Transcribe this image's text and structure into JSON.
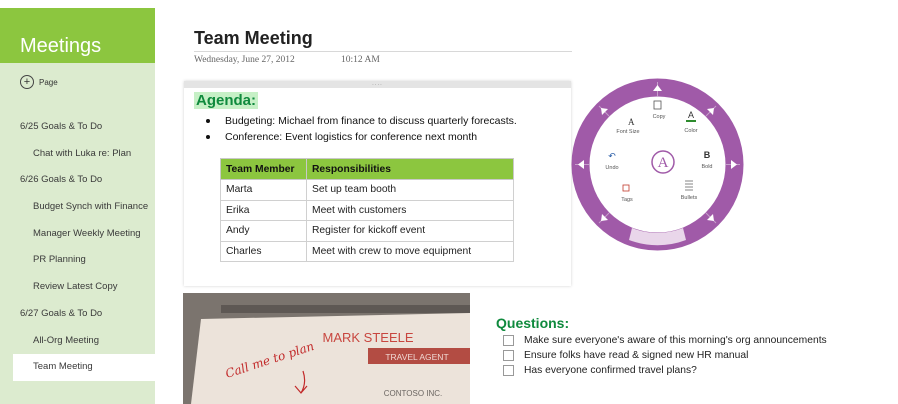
{
  "notebook": {
    "section_title": "Meetings",
    "add_page_label": "Page",
    "pages": [
      {
        "label": "6/25 Goals & To Do",
        "level": 0
      },
      {
        "label": "Chat with Luka re: Plan",
        "level": 1
      },
      {
        "label": "6/26 Goals & To Do",
        "level": 0
      },
      {
        "label": "Budget Synch with Finance",
        "level": 1
      },
      {
        "label": "Manager Weekly Meeting",
        "level": 1
      },
      {
        "label": "PR Planning",
        "level": 1
      },
      {
        "label": "Review Latest Copy",
        "level": 1
      },
      {
        "label": "6/27 Goals & To Do",
        "level": 0
      },
      {
        "label": "All-Org Meeting",
        "level": 1
      },
      {
        "label": "Team Meeting",
        "level": 1,
        "selected": true
      }
    ]
  },
  "page": {
    "title": "Team Meeting",
    "date": "Wednesday, June 27, 2012",
    "time": "10:12 AM"
  },
  "agenda": {
    "handle": "....",
    "heading": "Agenda:",
    "bullets": [
      "Budgeting:  Michael from finance to discuss quarterly forecasts.",
      "Conference: Event logistics for conference next month"
    ],
    "table": {
      "headers": [
        "Team Member",
        "Responsibilities"
      ],
      "rows": [
        [
          "Marta",
          "Set up team booth"
        ],
        [
          "Erika",
          "Meet with customers"
        ],
        [
          "Andy",
          "Register for kickoff event"
        ],
        [
          "Charles",
          "Meet with crew to move equipment"
        ]
      ]
    }
  },
  "radial_menu": {
    "center_label": "A",
    "items": {
      "copy": "Copy",
      "font_size": "Font Size",
      "color": "Color",
      "undo": "Undo",
      "bold": "Bold",
      "tags": "Tags",
      "bullets": "Bullets"
    },
    "accent_color": "#a05aa8"
  },
  "photo": {
    "name": "MARK STEELE",
    "role": "TRAVEL AGENT",
    "company": "CONTOSO INC.",
    "handwriting": "Call me to plan"
  },
  "questions": {
    "heading": "Questions:",
    "items": [
      "Make sure everyone's aware of this morning's org announcements",
      "Ensure folks have read & signed new HR manual",
      "Has everyone confirmed travel plans?"
    ]
  },
  "colors": {
    "brand_green": "#8cc63f",
    "sidebar_bg": "#dcebcf",
    "heading_green": "#0f8a3d",
    "radial_purple": "#a05aa8"
  }
}
